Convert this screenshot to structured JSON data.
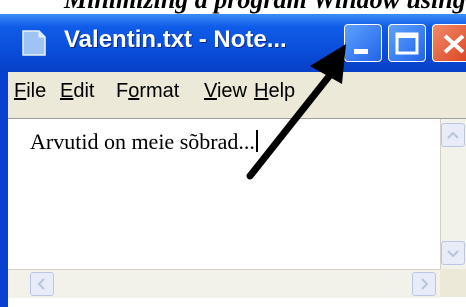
{
  "caption": {
    "text": "Minimizing a program Window using"
  },
  "window": {
    "title": "Valentin.txt - Note...",
    "icon": "notepad-icon",
    "controls": {
      "minimize": "minimize-icon",
      "maximize": "maximize-icon",
      "close": "close-icon"
    }
  },
  "menu": {
    "file": {
      "u": "F",
      "rest": "ile"
    },
    "edit": {
      "u": "E",
      "rest": "dit"
    },
    "format": {
      "pre": "F",
      "u": "o",
      "rest": "rmat"
    },
    "view": {
      "u": "V",
      "rest": "iew"
    },
    "help": {
      "u": "H",
      "rest": "elp"
    }
  },
  "document": {
    "text": "Arvutid on meie sõbrad..."
  },
  "colors": {
    "titlebar": "#0a4fdc",
    "menubar": "#ece9d8",
    "close": "#d8401c"
  }
}
